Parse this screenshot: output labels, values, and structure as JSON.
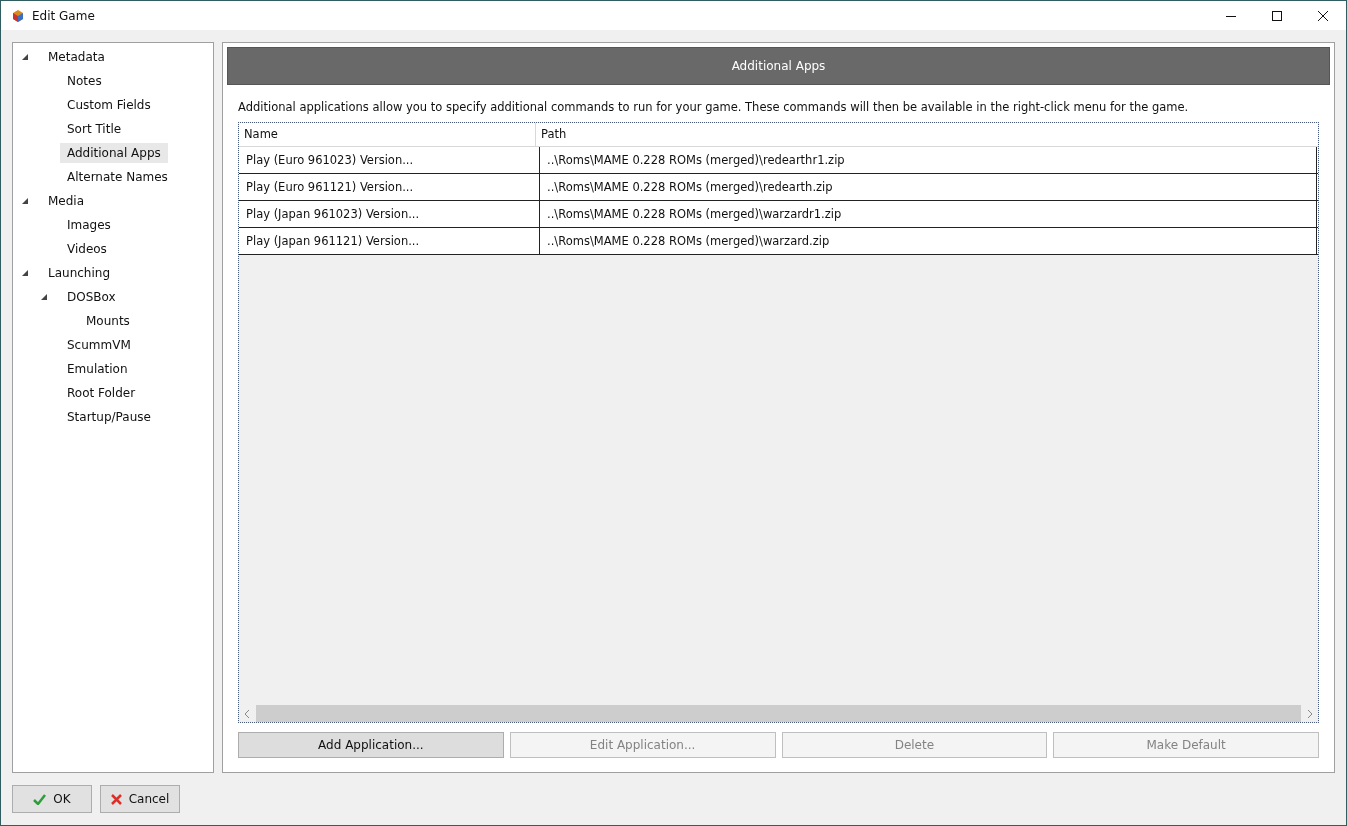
{
  "window": {
    "title": "Edit Game"
  },
  "sidebar": {
    "items": [
      {
        "label": "Metadata",
        "expanded": true,
        "selected": false,
        "children": [
          {
            "label": "Notes",
            "selected": false
          },
          {
            "label": "Custom Fields",
            "selected": false
          },
          {
            "label": "Sort Title",
            "selected": false
          },
          {
            "label": "Additional Apps",
            "selected": true
          },
          {
            "label": "Alternate Names",
            "selected": false
          }
        ]
      },
      {
        "label": "Media",
        "expanded": true,
        "selected": false,
        "children": [
          {
            "label": "Images",
            "selected": false
          },
          {
            "label": "Videos",
            "selected": false
          }
        ]
      },
      {
        "label": "Launching",
        "expanded": true,
        "selected": false,
        "children": [
          {
            "label": "DOSBox",
            "expanded": true,
            "selected": false,
            "children": [
              {
                "label": "Mounts",
                "selected": false
              }
            ]
          },
          {
            "label": "ScummVM",
            "selected": false
          },
          {
            "label": "Emulation",
            "selected": false
          },
          {
            "label": "Root Folder",
            "selected": false
          },
          {
            "label": "Startup/Pause",
            "selected": false
          }
        ]
      }
    ]
  },
  "panel": {
    "title": "Additional Apps",
    "description": "Additional applications allow you to specify additional commands to run for your game.  These commands will then be available in the right-click menu for the game."
  },
  "table": {
    "columns": [
      "Name",
      "Path"
    ],
    "rows": [
      [
        "Play (Euro 961023) Version...",
        "..\\Roms\\MAME 0.228 ROMs (merged)\\redearthr1.zip"
      ],
      [
        "Play (Euro 961121) Version...",
        "..\\Roms\\MAME 0.228 ROMs (merged)\\redearth.zip"
      ],
      [
        "Play (Japan 961023) Version...",
        "..\\Roms\\MAME 0.228 ROMs (merged)\\warzardr1.zip"
      ],
      [
        "Play (Japan 961121) Version...",
        "..\\Roms\\MAME 0.228 ROMs (merged)\\warzard.zip"
      ]
    ]
  },
  "actions": [
    {
      "label": "Add Application...",
      "disabled": false
    },
    {
      "label": "Edit Application...",
      "disabled": true
    },
    {
      "label": "Delete",
      "disabled": true
    },
    {
      "label": "Make Default",
      "disabled": true
    }
  ],
  "footer": [
    {
      "label": "OK",
      "kind": "ok"
    },
    {
      "label": "Cancel",
      "kind": "cancel"
    }
  ]
}
